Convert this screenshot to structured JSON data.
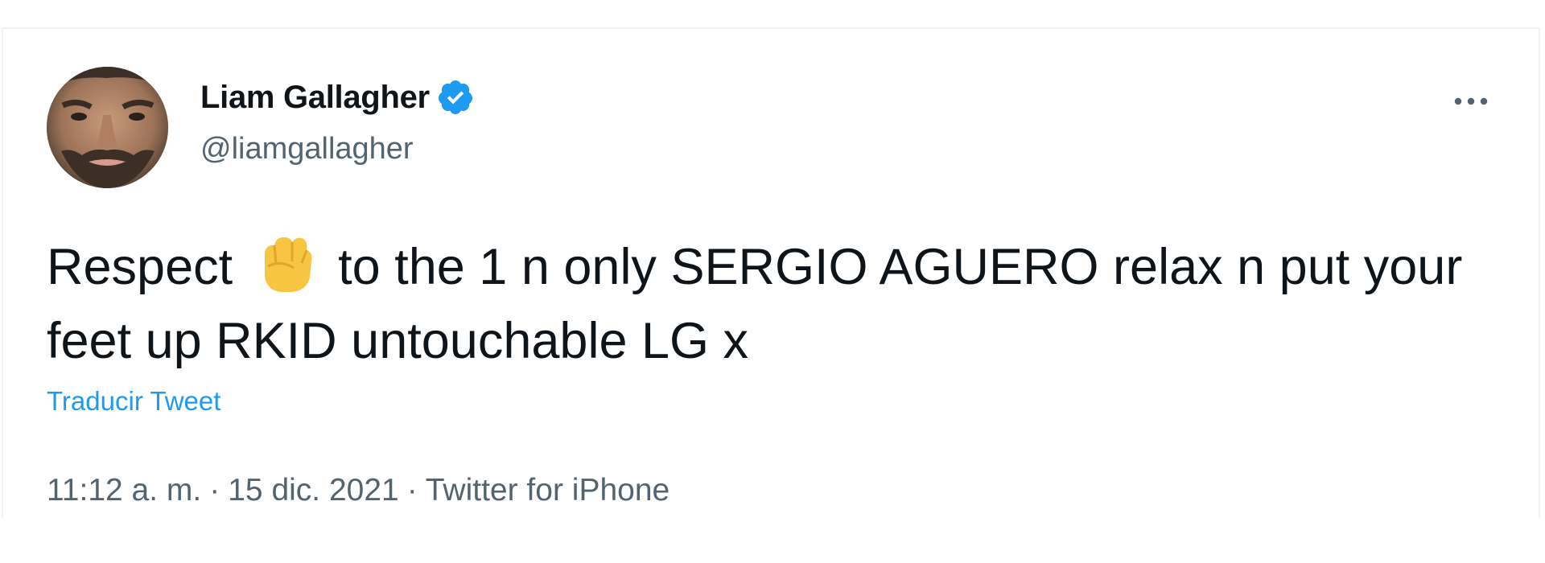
{
  "author": {
    "display_name": "Liam Gallagher",
    "handle": "@liamgallagher",
    "verified": true,
    "avatar_icon": "user-avatar-photo"
  },
  "menu": {
    "icon": "more-horizontal-icon"
  },
  "tweet": {
    "text_before_emoji": "Respect",
    "emoji_icon": "raised-fist-emoji",
    "text_after_emoji": "to the 1 n only SERGIO AGUERO relax n put your feet up RKID untouchable LG x",
    "translate_label": "Traducir Tweet",
    "time": "11:12 a. m.",
    "date": "15 dic. 2021",
    "separator": "·",
    "source": "Twitter for iPhone"
  },
  "colors": {
    "accent": "#1d9bf0",
    "text_primary": "#0f1419",
    "text_secondary": "#536471",
    "border": "#eff3f4",
    "emoji_fist": "#f7c542"
  }
}
